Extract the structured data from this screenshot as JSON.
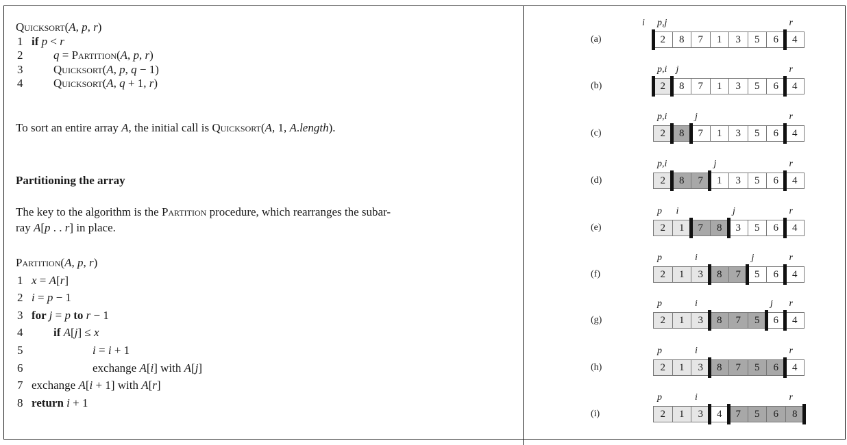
{
  "left": {
    "quicksort": [
      {
        "n": "",
        "indent": 0,
        "segs": [
          [
            "sc",
            "Quicksort"
          ],
          [
            "n",
            "("
          ],
          [
            "i",
            "A"
          ],
          [
            "n",
            ", "
          ],
          [
            "i",
            "p"
          ],
          [
            "n",
            ", "
          ],
          [
            "i",
            "r"
          ],
          [
            "n",
            ")"
          ]
        ]
      },
      {
        "n": "1",
        "indent": 1,
        "segs": [
          [
            "b",
            "if "
          ],
          [
            "i",
            "p"
          ],
          [
            "n",
            " < "
          ],
          [
            "i",
            "r"
          ]
        ]
      },
      {
        "n": "2",
        "indent": 2,
        "segs": [
          [
            "i",
            "q"
          ],
          [
            "n",
            " = "
          ],
          [
            "sc",
            "Partition"
          ],
          [
            "n",
            "("
          ],
          [
            "i",
            "A"
          ],
          [
            "n",
            ", "
          ],
          [
            "i",
            "p"
          ],
          [
            "n",
            ", "
          ],
          [
            "i",
            "r"
          ],
          [
            "n",
            ")"
          ]
        ]
      },
      {
        "n": "3",
        "indent": 2,
        "segs": [
          [
            "sc",
            "Quicksort"
          ],
          [
            "n",
            "("
          ],
          [
            "i",
            "A"
          ],
          [
            "n",
            ", "
          ],
          [
            "i",
            "p"
          ],
          [
            "n",
            ", "
          ],
          [
            "i",
            "q"
          ],
          [
            "n",
            " − 1)"
          ]
        ]
      },
      {
        "n": "4",
        "indent": 2,
        "segs": [
          [
            "sc",
            "Quicksort"
          ],
          [
            "n",
            "("
          ],
          [
            "i",
            "A"
          ],
          [
            "n",
            ", "
          ],
          [
            "i",
            "q"
          ],
          [
            "n",
            " + 1, "
          ],
          [
            "i",
            "r"
          ],
          [
            "n",
            ")"
          ]
        ]
      }
    ],
    "initial_call": [
      [
        "n",
        "To sort an entire array "
      ],
      [
        "i",
        "A"
      ],
      [
        "n",
        ", the initial call is "
      ],
      [
        "sc",
        "Quicksort"
      ],
      [
        "n",
        "("
      ],
      [
        "i",
        "A"
      ],
      [
        "n",
        ", 1, "
      ],
      [
        "i",
        "A"
      ],
      [
        "n",
        "."
      ],
      [
        "i",
        "length"
      ],
      [
        "n",
        ")."
      ]
    ],
    "section_heading": "Partitioning the array",
    "para1": [
      [
        "n",
        "The key to the algorithm is the "
      ],
      [
        "sc",
        "Partition"
      ],
      [
        "n",
        " procedure, which rearranges the subar-"
      ]
    ],
    "para2": [
      [
        "n",
        "ray "
      ],
      [
        "i",
        "A"
      ],
      [
        "n",
        "["
      ],
      [
        "i",
        "p"
      ],
      [
        "n",
        " . . "
      ],
      [
        "i",
        "r"
      ],
      [
        "n",
        "] in place."
      ]
    ],
    "partition": [
      {
        "n": "",
        "indent": 0,
        "segs": [
          [
            "sc",
            "Partition"
          ],
          [
            "n",
            "("
          ],
          [
            "i",
            "A"
          ],
          [
            "n",
            ", "
          ],
          [
            "i",
            "p"
          ],
          [
            "n",
            ", "
          ],
          [
            "i",
            "r"
          ],
          [
            "n",
            ")"
          ]
        ]
      },
      {
        "n": "1",
        "indent": 1,
        "segs": [
          [
            "i",
            "x"
          ],
          [
            "n",
            " = "
          ],
          [
            "i",
            "A"
          ],
          [
            "n",
            "["
          ],
          [
            "i",
            "r"
          ],
          [
            "n",
            "]"
          ]
        ]
      },
      {
        "n": "2",
        "indent": 1,
        "segs": [
          [
            "i",
            "i"
          ],
          [
            "n",
            " = "
          ],
          [
            "i",
            "p"
          ],
          [
            "n",
            " − 1"
          ]
        ]
      },
      {
        "n": "3",
        "indent": 1,
        "segs": [
          [
            "b",
            "for "
          ],
          [
            "i",
            "j"
          ],
          [
            "n",
            " = "
          ],
          [
            "i",
            "p"
          ],
          [
            "b",
            " to "
          ],
          [
            "i",
            "r"
          ],
          [
            "n",
            " − 1"
          ]
        ]
      },
      {
        "n": "4",
        "indent": 2,
        "segs": [
          [
            "b",
            "if "
          ],
          [
            "i",
            "A"
          ],
          [
            "n",
            "["
          ],
          [
            "i",
            "j"
          ],
          [
            "n",
            "] ≤ "
          ],
          [
            "i",
            "x"
          ]
        ]
      },
      {
        "n": "5",
        "indent": 3,
        "segs": [
          [
            "i",
            "i"
          ],
          [
            "n",
            " = "
          ],
          [
            "i",
            "i"
          ],
          [
            "n",
            " + 1"
          ]
        ]
      },
      {
        "n": "6",
        "indent": 3,
        "segs": [
          [
            "n",
            "exchange "
          ],
          [
            "i",
            "A"
          ],
          [
            "n",
            "["
          ],
          [
            "i",
            "i"
          ],
          [
            "n",
            "] with "
          ],
          [
            "i",
            "A"
          ],
          [
            "n",
            "["
          ],
          [
            "i",
            "j"
          ],
          [
            "n",
            "]"
          ]
        ]
      },
      {
        "n": "7",
        "indent": 1,
        "segs": [
          [
            "n",
            "exchange "
          ],
          [
            "i",
            "A"
          ],
          [
            "n",
            "["
          ],
          [
            "i",
            "i"
          ],
          [
            "n",
            " + 1] with "
          ],
          [
            "i",
            "A"
          ],
          [
            "n",
            "["
          ],
          [
            "i",
            "r"
          ],
          [
            "n",
            "]"
          ]
        ]
      },
      {
        "n": "8",
        "indent": 1,
        "segs": [
          [
            "b",
            "return "
          ],
          [
            "i",
            "i"
          ],
          [
            "n",
            " + 1"
          ]
        ]
      }
    ]
  },
  "figure": {
    "rows": [
      {
        "label": "(a)",
        "values": [
          "2",
          "8",
          "7",
          "1",
          "3",
          "5",
          "6",
          "4"
        ],
        "shade": [
          0,
          0,
          0,
          0,
          0,
          0,
          0,
          0
        ],
        "bars": [
          0,
          7
        ],
        "pointers": [
          {
            "t": "i",
            "at": -1
          },
          {
            "t": "p,j",
            "at": 0
          },
          {
            "t": "r",
            "at": 7
          }
        ]
      },
      {
        "label": "(b)",
        "values": [
          "2",
          "8",
          "7",
          "1",
          "3",
          "5",
          "6",
          "4"
        ],
        "shade": [
          1,
          0,
          0,
          0,
          0,
          0,
          0,
          0
        ],
        "bars": [
          0,
          1,
          7
        ],
        "pointers": [
          {
            "t": "p,i",
            "at": 0
          },
          {
            "t": "j",
            "at": 1
          },
          {
            "t": "r",
            "at": 7
          }
        ]
      },
      {
        "label": "(c)",
        "values": [
          "2",
          "8",
          "7",
          "1",
          "3",
          "5",
          "6",
          "4"
        ],
        "shade": [
          1,
          2,
          0,
          0,
          0,
          0,
          0,
          0
        ],
        "bars": [
          1,
          2,
          7
        ],
        "pointers": [
          {
            "t": "p,i",
            "at": 0
          },
          {
            "t": "j",
            "at": 2
          },
          {
            "t": "r",
            "at": 7
          }
        ]
      },
      {
        "label": "(d)",
        "values": [
          "2",
          "8",
          "7",
          "1",
          "3",
          "5",
          "6",
          "4"
        ],
        "shade": [
          1,
          2,
          2,
          0,
          0,
          0,
          0,
          0
        ],
        "bars": [
          1,
          3,
          7
        ],
        "pointers": [
          {
            "t": "p,i",
            "at": 0
          },
          {
            "t": "j",
            "at": 3
          },
          {
            "t": "r",
            "at": 7
          }
        ]
      },
      {
        "label": "(e)",
        "values": [
          "2",
          "1",
          "7",
          "8",
          "3",
          "5",
          "6",
          "4"
        ],
        "shade": [
          1,
          1,
          2,
          2,
          0,
          0,
          0,
          0
        ],
        "bars": [
          2,
          4,
          7
        ],
        "pointers": [
          {
            "t": "p",
            "at": 0
          },
          {
            "t": "i",
            "at": 1
          },
          {
            "t": "j",
            "at": 4
          },
          {
            "t": "r",
            "at": 7
          }
        ]
      },
      {
        "label": "(f)",
        "values": [
          "2",
          "1",
          "3",
          "8",
          "7",
          "5",
          "6",
          "4"
        ],
        "shade": [
          1,
          1,
          1,
          2,
          2,
          0,
          0,
          0
        ],
        "bars": [
          3,
          5,
          7
        ],
        "pointers": [
          {
            "t": "p",
            "at": 0
          },
          {
            "t": "i",
            "at": 2
          },
          {
            "t": "j",
            "at": 5
          },
          {
            "t": "r",
            "at": 7
          }
        ]
      },
      {
        "label": "(g)",
        "values": [
          "2",
          "1",
          "3",
          "8",
          "7",
          "5",
          "6",
          "4"
        ],
        "shade": [
          1,
          1,
          1,
          2,
          2,
          2,
          0,
          0
        ],
        "bars": [
          3,
          6,
          7
        ],
        "pointers": [
          {
            "t": "p",
            "at": 0
          },
          {
            "t": "i",
            "at": 2
          },
          {
            "t": "j",
            "at": 6
          },
          {
            "t": "r",
            "at": 7
          }
        ]
      },
      {
        "label": "(h)",
        "values": [
          "2",
          "1",
          "3",
          "8",
          "7",
          "5",
          "6",
          "4"
        ],
        "shade": [
          1,
          1,
          1,
          2,
          2,
          2,
          2,
          0
        ],
        "bars": [
          3,
          7
        ],
        "pointers": [
          {
            "t": "p",
            "at": 0
          },
          {
            "t": "i",
            "at": 2
          },
          {
            "t": "r",
            "at": 7
          }
        ]
      },
      {
        "label": "(i)",
        "values": [
          "2",
          "1",
          "3",
          "4",
          "7",
          "5",
          "6",
          "8"
        ],
        "shade": [
          1,
          1,
          1,
          0,
          2,
          2,
          2,
          2
        ],
        "bars": [
          3,
          4,
          8
        ],
        "pointers": [
          {
            "t": "p",
            "at": 0
          },
          {
            "t": "i",
            "at": 2
          },
          {
            "t": "r",
            "at": 7
          }
        ]
      }
    ],
    "colors": {
      "white": "#ffffff",
      "light": "#e6e6e6",
      "dark": "#a8a8a8",
      "bar": "#111111"
    }
  }
}
